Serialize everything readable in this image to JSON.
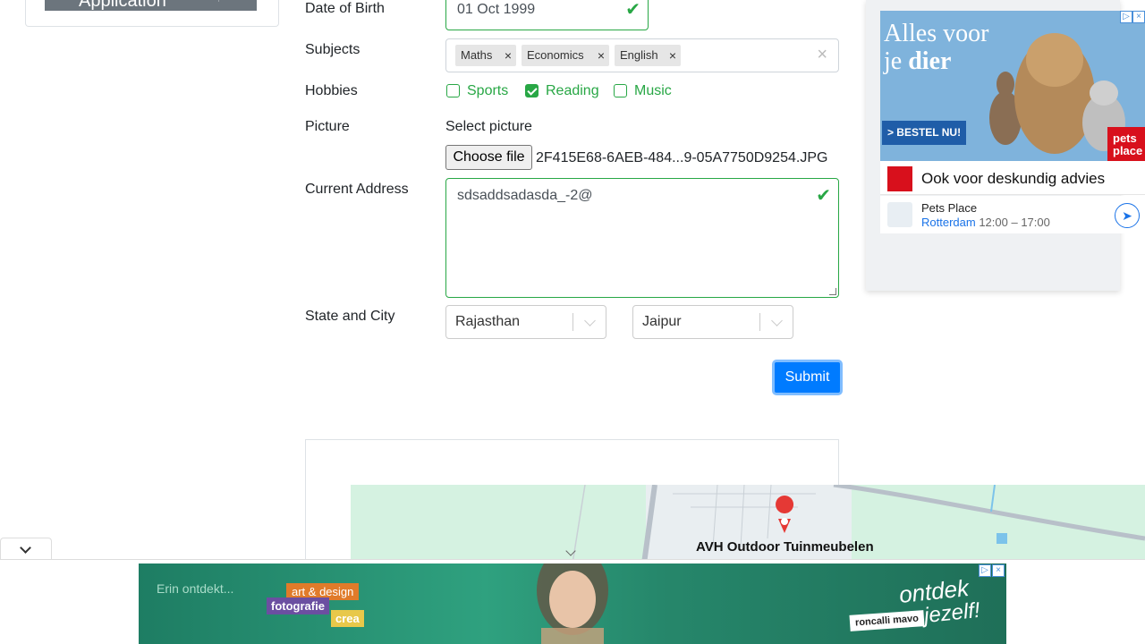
{
  "sidebar": {
    "application_label": "Application"
  },
  "form": {
    "dob_label": "Date of Birth",
    "dob_value": "01 Oct 1999",
    "subjects_label": "Subjects",
    "subjects": [
      "Maths",
      "Economics",
      "English"
    ],
    "hobbies_label": "Hobbies",
    "hobbies": [
      {
        "label": "Sports",
        "checked": false
      },
      {
        "label": "Reading",
        "checked": true
      },
      {
        "label": "Music",
        "checked": false
      }
    ],
    "picture_label": "Picture",
    "select_picture_label": "Select picture",
    "choose_file_label": "Choose file",
    "file_name": "2F415E68-6AEB-484...9-05A7750D9254.JPG",
    "address_label": "Current Address",
    "address_value": "sdsaddsadasda_-2@",
    "state_city_label": "State and City",
    "state": "Rajasthan",
    "city": "Jaipur",
    "submit_label": "Submit"
  },
  "map": {
    "place_label": "AVH Outdoor Tuinmeubelen"
  },
  "ad_right": {
    "headline_1": "Alles voor",
    "headline_2a": "je ",
    "headline_2b": "dier",
    "cta": "> BESTEL NU!",
    "brand_1": "pets",
    "brand_2": "place",
    "advice": "Ook voor deskundig advies",
    "store_name": "Pets Place",
    "store_city": "Rotterdam",
    "store_hours": "12:00 – 17:00"
  },
  "ad_bottom": {
    "teaser": "Erin ontdekt...",
    "tag_1": "art & design",
    "tag_2": "fotografie",
    "tag_3": "crea",
    "slogan_1": "ontdek",
    "slogan_2": "jezelf!",
    "brand": "roncalli mavo"
  },
  "colors": {
    "valid_green": "#28a745",
    "primary_blue": "#007bff",
    "ad_green": "#2fa17f"
  },
  "icons": {
    "valid": "check-icon",
    "remove": "close-icon",
    "dropdown": "chevron-down-icon"
  }
}
